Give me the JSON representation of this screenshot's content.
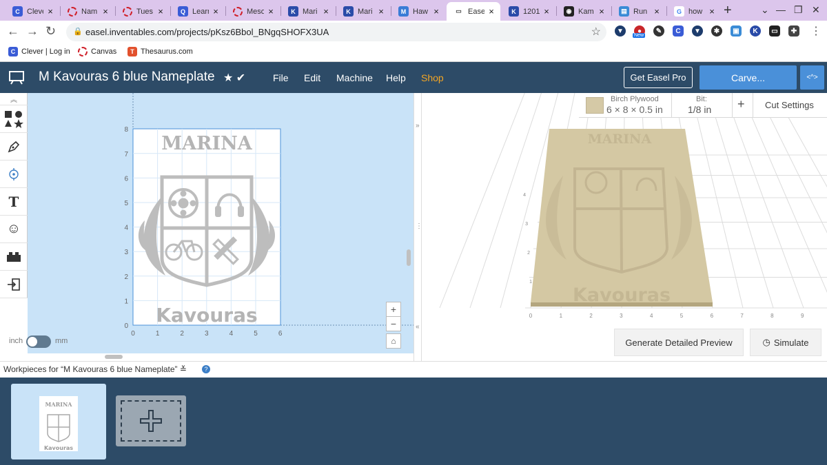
{
  "browser": {
    "tabs": [
      {
        "label": "Clever",
        "icon": "clever-icon",
        "color": "#3a5cd6"
      },
      {
        "label": "Nam",
        "icon": "canvas-icon",
        "color": "#d0202a"
      },
      {
        "label": "Tues",
        "icon": "canvas-icon",
        "color": "#d0202a"
      },
      {
        "label": "Learn",
        "icon": "quizlet-icon",
        "color": "#3a5cd6"
      },
      {
        "label": "Meso",
        "icon": "canvas-icon",
        "color": "#d0202a"
      },
      {
        "label": "Mari",
        "icon": "k-icon",
        "color": "#2a4ba8"
      },
      {
        "label": "Mari",
        "icon": "k-icon",
        "color": "#2a4ba8"
      },
      {
        "label": "Haw",
        "icon": "m-icon",
        "color": "#3a7cd6"
      },
      {
        "label": "Ease",
        "icon": "easel-icon",
        "color": "#444444"
      },
      {
        "label": "1201",
        "icon": "k-icon",
        "color": "#2a4ba8"
      },
      {
        "label": "Kam",
        "icon": "globe-icon",
        "color": "#222222"
      },
      {
        "label": "Run",
        "icon": "docs-icon",
        "color": "#3a8bd6"
      },
      {
        "label": "how",
        "icon": "google-icon",
        "color": "#ffffff"
      }
    ],
    "url": "easel.inventables.com/projects/pKsz6Bbol_BNgqSHOFX3UA",
    "bookmarks": [
      {
        "label": "Clever | Log in",
        "icon": "clever-icon",
        "color": "#3a5cd6"
      },
      {
        "label": "Canvas",
        "icon": "canvas-icon",
        "color": "#d0202a"
      },
      {
        "label": "Thesaurus.com",
        "icon": "thesaurus-icon",
        "color": "#e2512d"
      }
    ],
    "extension_badge": "New"
  },
  "app": {
    "title": "M Kavouras 6 blue Nameplate",
    "menu": [
      "File",
      "Edit",
      "Machine",
      "Help",
      "Shop"
    ],
    "pro_button": "Get Easel Pro",
    "carve_button": "Carve...",
    "accent": "#4a90d9",
    "header_color": "#2d4b67"
  },
  "canvas": {
    "x_ticks": [
      "0",
      "1",
      "2",
      "3",
      "4",
      "5",
      "6"
    ],
    "y_ticks": [
      "0",
      "1",
      "2",
      "3",
      "4",
      "5",
      "6",
      "7",
      "8"
    ],
    "design_top_text": "MARINA",
    "design_bottom_text": "Kavouras",
    "unit_left": "inch",
    "unit_right": "mm"
  },
  "preview": {
    "material_name": "Birch Plywood",
    "material_size": "6 × 8 × 0.5 in",
    "bit_label": "Bit:",
    "bit_value": "1/8 in",
    "cut_settings": "Cut Settings",
    "x_ticks": [
      "0",
      "1",
      "2",
      "3",
      "4",
      "5",
      "6",
      "7",
      "8",
      "9"
    ],
    "y_ticks": [
      "1",
      "2",
      "3",
      "4"
    ],
    "generate_button": "Generate Detailed Preview",
    "simulate_button": "Simulate"
  },
  "workpieces": {
    "label": "Workpieces for “M Kavouras 6 blue Nameplate”",
    "help": "?"
  }
}
